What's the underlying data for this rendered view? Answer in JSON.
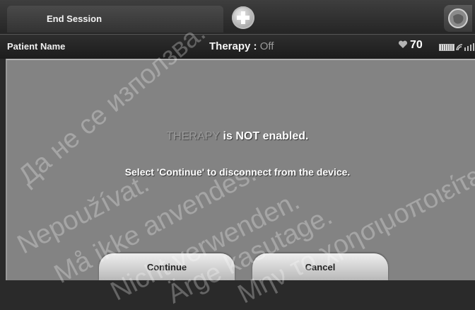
{
  "header": {
    "end_session_label": "End Session",
    "add_icon": "plus-circle-icon",
    "device_icon": "device-icon"
  },
  "status_bar": {
    "patient_name": "Patient Name",
    "therapy_label": "Therapy : ",
    "therapy_value": "Off",
    "heart_rate": "70",
    "heart_icon": "heart-icon",
    "battery_icon": "battery-icon",
    "signal_icon": "signal-icon"
  },
  "dialog": {
    "therapy_word": "THERAPY",
    "line1_rest": " is NOT enabled.",
    "line2": "Select 'Continue' to disconnect from the device."
  },
  "buttons": {
    "continue_label": "Continue",
    "cancel_label": "Cancel"
  },
  "watermarks": [
    "Да не се използва.",
    "Nepoužívat.",
    "Må ikke anvendes.",
    "Nicht verwenden.",
    "Ärge kasutage.",
    "Μην το χρησιμοποιείτε."
  ],
  "colors": {
    "main_background": "#838383",
    "top_bar": "#2e2e2e",
    "button": "#e0e0e0"
  }
}
